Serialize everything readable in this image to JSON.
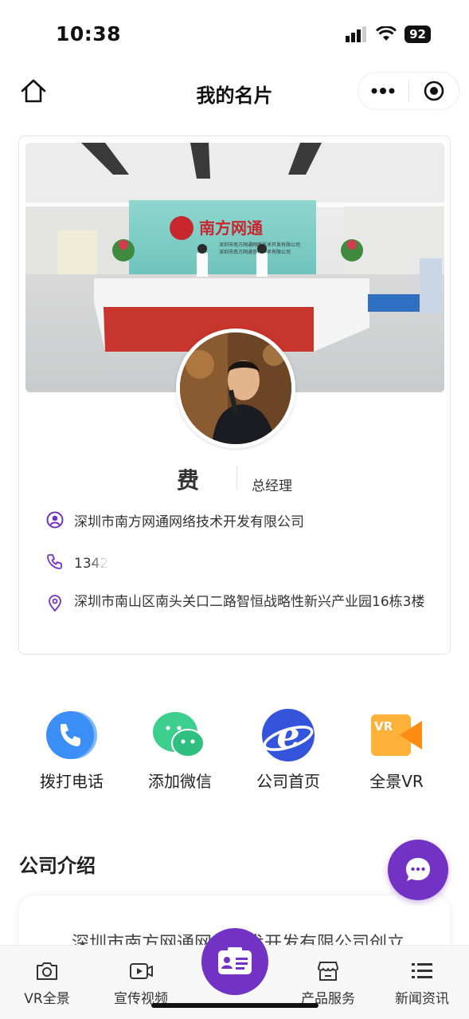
{
  "status_bar": {
    "time": "10:38",
    "battery": "92"
  },
  "nav": {
    "title": "我的名片"
  },
  "card": {
    "name": "费",
    "position": "总经理",
    "company": "深圳市南方网通网络技术开发有限公司",
    "phone": "1342",
    "address": "深圳市南山区南头关口二路智恒战略性新兴产业园16栋3楼",
    "banner": {
      "logo_text": "南方网通",
      "sign_line1": "深圳市南方网通网络技术开发有限公司",
      "sign_line2": "深圳市南方网通信息技术有限公司"
    }
  },
  "actions": [
    {
      "label": "拨打电话",
      "icon": "phone-icon"
    },
    {
      "label": "添加微信",
      "icon": "wechat-icon"
    },
    {
      "label": "公司首页",
      "icon": "browser-icon"
    },
    {
      "label": "全景VR",
      "icon": "vr-camera-icon"
    }
  ],
  "intro": {
    "title": "公司介绍",
    "text": "深圳市南方网通网络技术开发有限公司创立"
  },
  "tabbar": [
    {
      "label": "VR全景",
      "icon": "camera-icon"
    },
    {
      "label": "宣传视频",
      "icon": "video-icon"
    },
    {
      "label": "",
      "icon": "business-card-icon"
    },
    {
      "label": "产品服务",
      "icon": "store-icon"
    },
    {
      "label": "新闻资讯",
      "icon": "list-icon"
    }
  ],
  "colors": {
    "accent": "#7232c4",
    "phone": "#3a8ef6",
    "wechat": "#3ccf8e",
    "browser": "#3455db",
    "vr": "#ff9a1f"
  }
}
